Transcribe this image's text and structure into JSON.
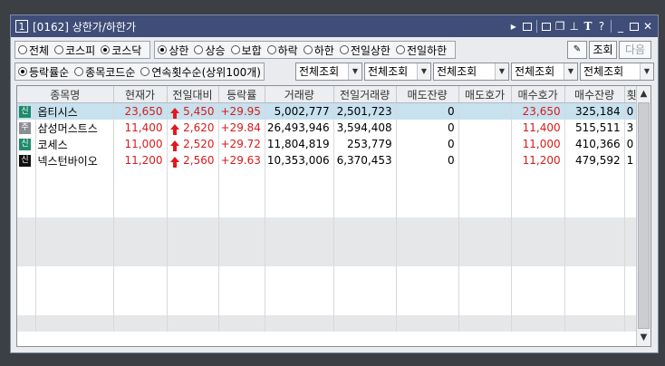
{
  "window": {
    "number": "1",
    "title": "[0162] 상한가/하한가",
    "controls": [
      "arrow-right-icon",
      "screen-icon",
      "link-icon",
      "copy-icon",
      "pin-icon",
      "font-icon",
      "help-icon",
      "minimize-icon",
      "maximize-icon",
      "close-icon"
    ]
  },
  "market_filter": {
    "options": [
      "전체",
      "코스피",
      "코스닥"
    ],
    "selected": "코스닥"
  },
  "limit_filter": {
    "options": [
      "상한",
      "상승",
      "보합",
      "하락",
      "하한",
      "전일상한",
      "전일하한"
    ],
    "selected": "상한"
  },
  "actions": {
    "settings_icon": "settings-icon",
    "query": "조회",
    "next": "다음"
  },
  "sort_filter": {
    "options": [
      "등락률순",
      "종목코드순",
      "연속횟수순(상위100개)"
    ],
    "selected": "등락률순"
  },
  "dropdowns": [
    "전체조회",
    "전체조회",
    "전체조회",
    "전체조회",
    "전체조회"
  ],
  "table": {
    "columns": [
      "종목명",
      "현재가",
      "전일대비",
      "등락률",
      "거래량",
      "전일거래량",
      "매도잔량",
      "매도호가",
      "매수호가",
      "매수잔량",
      "횟수"
    ],
    "rows": [
      {
        "tag": "신",
        "tag_color": "#1f8a6b",
        "name": "옵티시스",
        "price": "23,650",
        "change": "5,450",
        "rate": "+29.95",
        "volume": "5,002,777",
        "prev_volume": "2,501,723",
        "ask_qty": "0",
        "ask": "",
        "bid": "23,650",
        "bid_qty": "325,184",
        "count": "0"
      },
      {
        "tag": "주",
        "tag_color": "#8b8e93",
        "name": "삼성머스트스",
        "price": "11,400",
        "change": "2,620",
        "rate": "+29.84",
        "volume": "26,493,946",
        "prev_volume": "3,594,408",
        "ask_qty": "0",
        "ask": "",
        "bid": "11,400",
        "bid_qty": "515,511",
        "count": "3"
      },
      {
        "tag": "신",
        "tag_color": "#1f8a6b",
        "name": "코세스",
        "price": "11,000",
        "change": "2,520",
        "rate": "+29.72",
        "volume": "11,804,819",
        "prev_volume": "253,779",
        "ask_qty": "0",
        "ask": "",
        "bid": "11,000",
        "bid_qty": "410,366",
        "count": "0"
      },
      {
        "tag": "신",
        "tag_color": "#111111",
        "name": "넥스턴바이오",
        "price": "11,200",
        "change": "2,560",
        "rate": "+29.63",
        "volume": "10,353,006",
        "prev_volume": "6,370,453",
        "ask_qty": "0",
        "ask": "",
        "bid": "11,200",
        "bid_qty": "479,592",
        "count": "1"
      }
    ]
  },
  "colors": {
    "titlebar": "#3f4d78",
    "up": "#d81b1b",
    "selected_row": "#c7e1ee"
  }
}
